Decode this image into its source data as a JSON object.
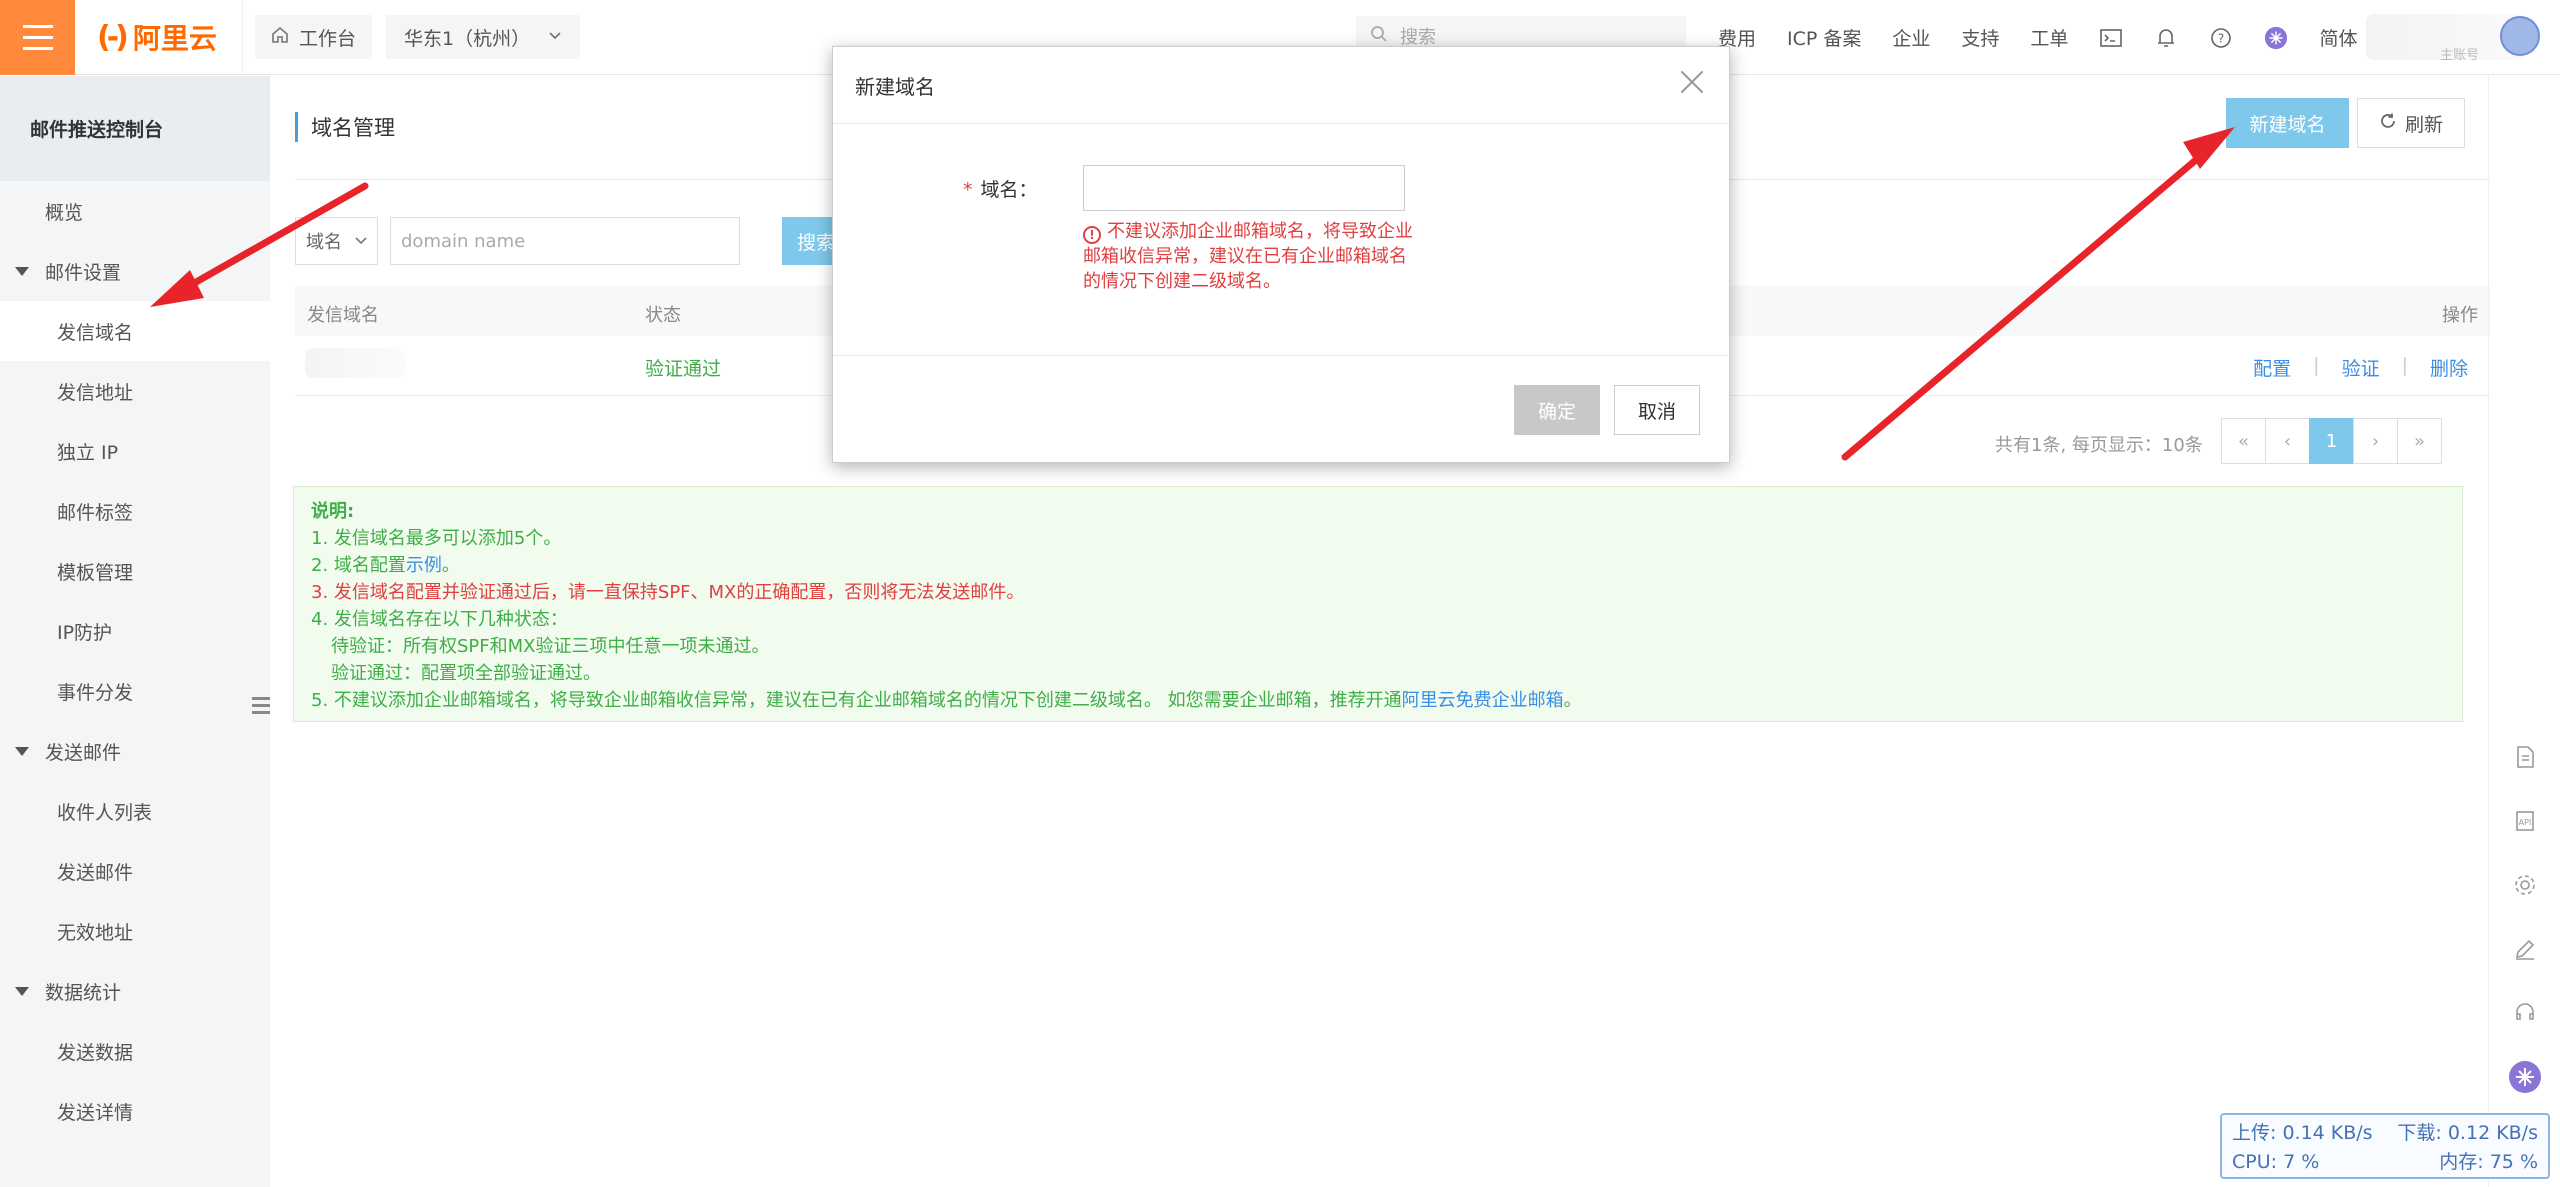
{
  "topbar": {
    "brand": "阿里云",
    "workbench": "工作台",
    "region": "华东1（杭州）",
    "search_placeholder": "搜索",
    "nav": [
      "费用",
      "ICP 备案",
      "企业",
      "支持",
      "工单"
    ],
    "lang": "简体",
    "account_sub": "主账号"
  },
  "sidebar": {
    "title": "邮件推送控制台",
    "overview": "概览",
    "group_mail_settings": "邮件设置",
    "items_settings": [
      "发信域名",
      "发信地址",
      "独立 IP",
      "邮件标签",
      "模板管理",
      "IP防护",
      "事件分发"
    ],
    "group_send": "发送邮件",
    "items_send": [
      "收件人列表",
      "发送邮件",
      "无效地址"
    ],
    "group_stats": "数据统计",
    "items_stats": [
      "发送数据",
      "发送详情"
    ]
  },
  "main": {
    "page_title": "域名管理",
    "new_domain_button": "新建域名",
    "refresh_button": "刷新",
    "filter_select": "域名",
    "filter_placeholder": "domain name",
    "search_button": "搜索",
    "table_headers": {
      "domain": "发信域名",
      "status": "状态",
      "actions": "操作"
    },
    "row": {
      "status": "验证通过",
      "actions": [
        "配置",
        "验证",
        "删除"
      ]
    },
    "pager_info": "共有1条, 每页显示：10条",
    "pager": {
      "first": "«",
      "prev": "‹",
      "current": "1",
      "next": "›",
      "last": "»"
    }
  },
  "note": {
    "title": "说明:",
    "l1": "1. 发信域名最多可以添加5个。",
    "l2_prefix": "2. 域名配置",
    "l2_link": "示例",
    "l2_suffix": "。",
    "l3": "3. 发信域名配置并验证通过后，请一直保持SPF、MX的正确配置，否则将无法发送邮件。",
    "l4": "4. 发信域名存在以下几种状态：",
    "l4a": "待验证：所有权SPF和MX验证三项中任意一项未通过。",
    "l4b": "验证通过：配置项全部验证通过。",
    "l5_prefix": "5. 不建议添加企业邮箱域名，将导致企业邮箱收信异常，建议在已有企业邮箱域名的情况下创建二级域名。 如您需要企业邮箱，推荐开通",
    "l5_link": "阿里云免费企业邮箱",
    "l5_suffix": "。"
  },
  "dialog": {
    "title": "新建域名",
    "field_label": "域名：",
    "required_mark": "*",
    "input_value": "",
    "warning": "不建议添加企业邮箱域名，将导致企业邮箱收信异常，建议在已有企业邮箱域名的情况下创建二级域名。",
    "ok_button": "确定",
    "cancel_button": "取消"
  },
  "netmon": {
    "upload": "上传: 0.14 KB/s",
    "download": "下载: 0.12 KB/s",
    "cpu": "CPU: 7 %",
    "mem": "内存: 75 %"
  },
  "colors": {
    "brand_orange": "#ff6a00",
    "primary_blue": "#7ec8ec",
    "success_green": "#3fae49",
    "danger_red": "#e04040",
    "arrow_red": "#e8242b"
  }
}
